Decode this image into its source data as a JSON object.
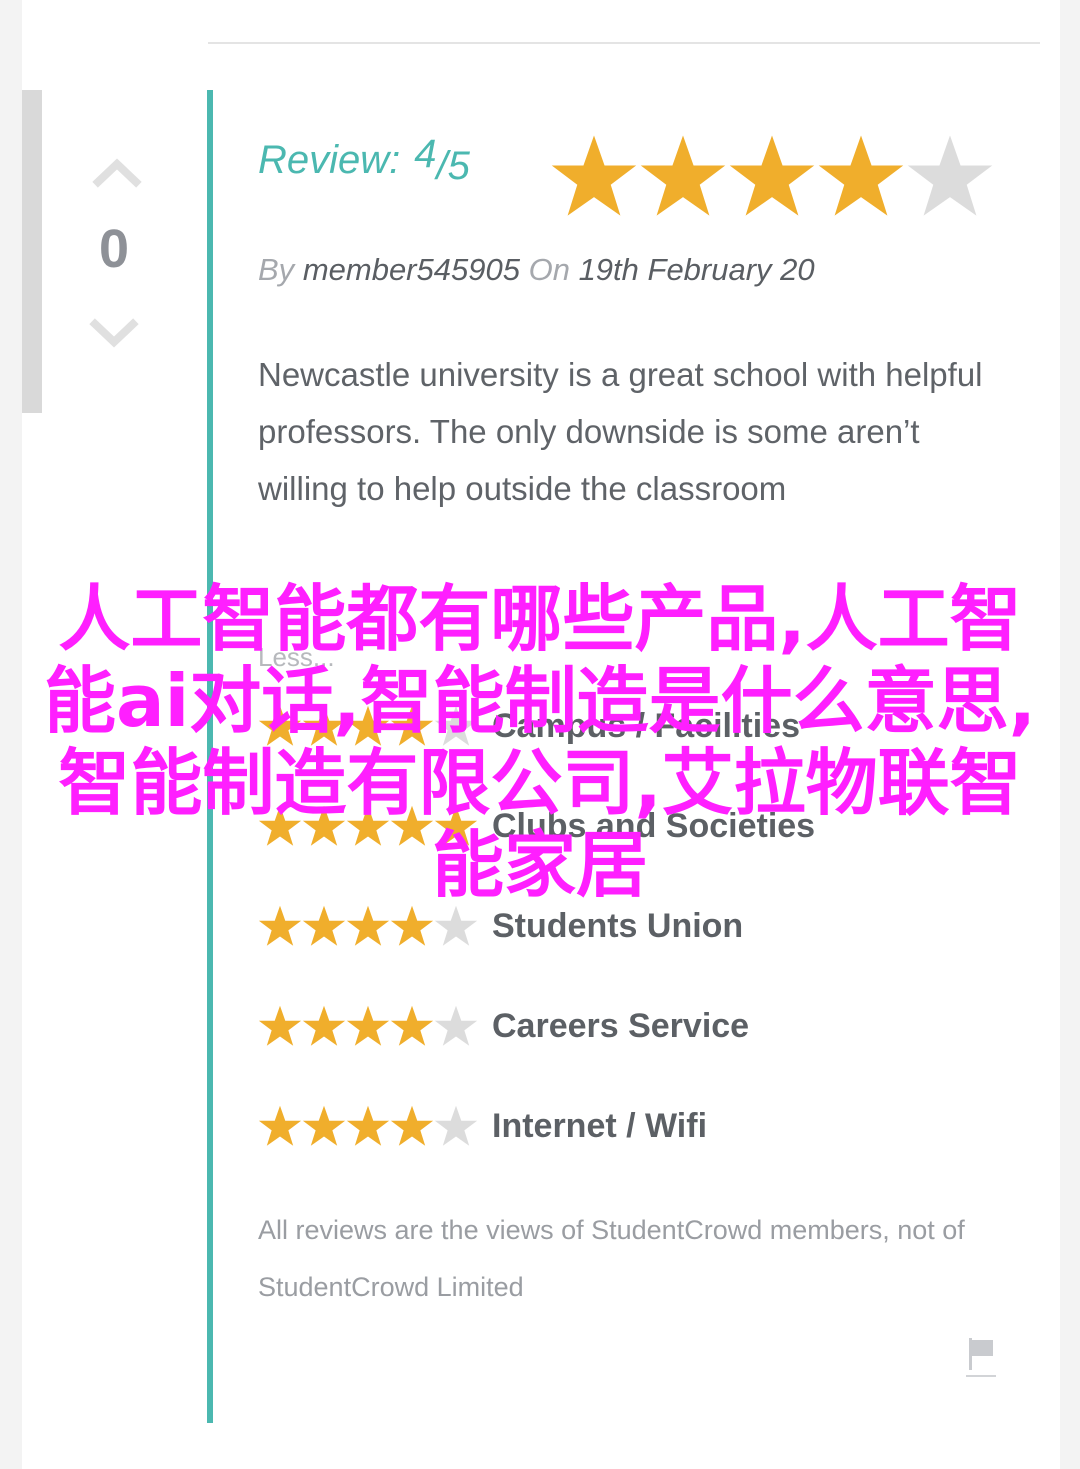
{
  "vote": {
    "count": "0"
  },
  "review": {
    "label": "Review:",
    "score": "4",
    "out_of": "/5",
    "rating": 4,
    "max_rating": 5,
    "by_label": "By",
    "author": "member545905",
    "on_label": "On",
    "date": "19th February 20",
    "body": "Newcastle university is a great school with helpful professors. The only downside is some aren’t willing to help outside the classroom",
    "less_link": "Less..."
  },
  "categories": [
    {
      "label": "Campus / Facilities",
      "rating": 4
    },
    {
      "label": "Clubs and Societies",
      "rating": 5
    },
    {
      "label": "Students Union",
      "rating": 4
    },
    {
      "label": "Careers Service",
      "rating": 4
    },
    {
      "label": "Internet / Wifi",
      "rating": 4
    }
  ],
  "disclaimer": "All reviews are the views of StudentCrowd members, not of StudentCrowd Limited",
  "overlay_text": "人工智能都有哪些产品,人工智能ai对话,智能制造是什么意思,智能制造有限公司,艾拉物联智能家居",
  "colors": {
    "accent": "#4bb8b0",
    "star_filled": "#f0ae2c",
    "star_empty": "#dcdcdc",
    "overlay": "#ff1fff"
  },
  "icons": {
    "vote_up": "chevron-up-icon",
    "vote_down": "chevron-down-icon",
    "report": "flag-icon",
    "rating": "star-icon"
  }
}
